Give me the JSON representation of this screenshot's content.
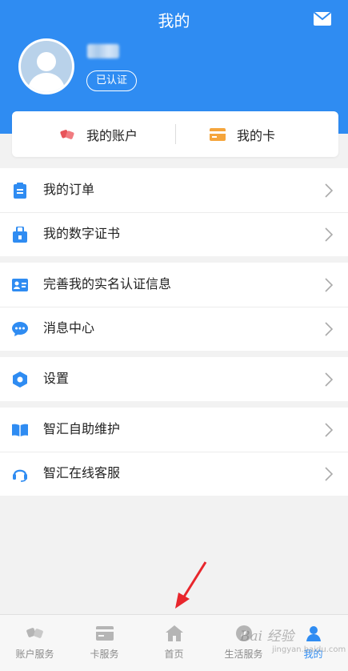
{
  "header": {
    "title": "我的",
    "user_name": "",
    "verified_badge": "已认证",
    "background_color": "#2f8cf2"
  },
  "card": {
    "account_label": "我的账户",
    "card_label": "我的卡"
  },
  "menu": {
    "group1": [
      {
        "label": "我的订单",
        "icon": "order-icon"
      },
      {
        "label": "我的数字证书",
        "icon": "certificate-icon"
      }
    ],
    "group2": [
      {
        "label": "完善我的实名认证信息",
        "icon": "id-card-icon"
      },
      {
        "label": "消息中心",
        "icon": "message-icon"
      }
    ],
    "group3": [
      {
        "label": "设置",
        "icon": "settings-icon"
      }
    ],
    "group4": [
      {
        "label": "智汇自助维护",
        "icon": "book-icon"
      },
      {
        "label": "智汇在线客服",
        "icon": "headset-icon"
      }
    ]
  },
  "tabbar": {
    "items": [
      {
        "label": "账户服务",
        "icon": "account-service-icon"
      },
      {
        "label": "卡服务",
        "icon": "card-service-icon"
      },
      {
        "label": "首页",
        "icon": "home-icon"
      },
      {
        "label": "生活服务",
        "icon": "compass-icon"
      },
      {
        "label": "我的",
        "icon": "user-icon",
        "active": true
      }
    ],
    "active_color": "#2f8cf2",
    "inactive_color": "#8a8a8a"
  },
  "watermark": {
    "text": "Bai 经验",
    "sub": "jingyan.baidu.com"
  }
}
